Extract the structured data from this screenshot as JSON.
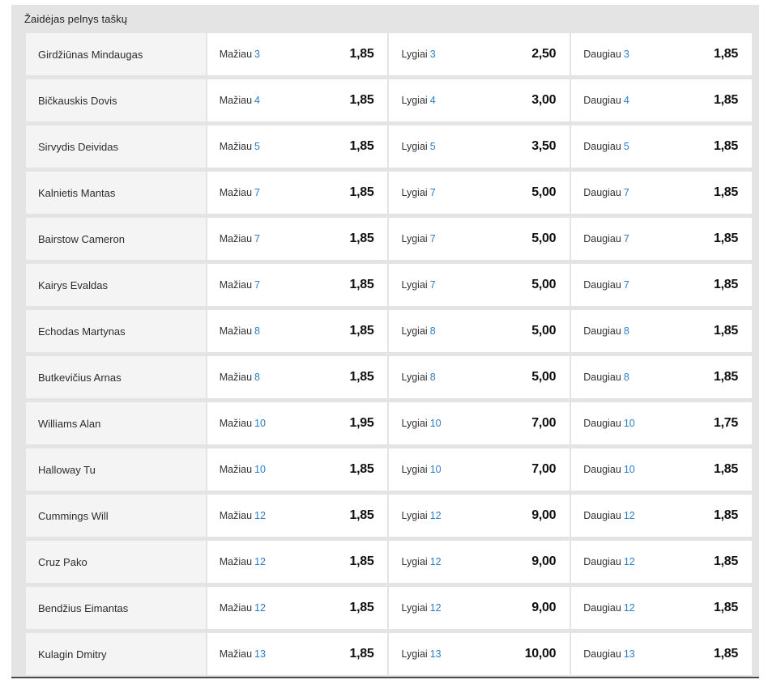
{
  "market": {
    "title": "Žaidėjas pelnys taškų",
    "labels": {
      "under": "Mažiau",
      "equal": "Lygiai",
      "over": "Daugiau"
    }
  },
  "rows": [
    {
      "player": "Girdžiūnas Mindaugas",
      "line": "3",
      "under": "1,85",
      "equal": "2,50",
      "over": "1,85"
    },
    {
      "player": "Bičkauskis Dovis",
      "line": "4",
      "under": "1,85",
      "equal": "3,00",
      "over": "1,85"
    },
    {
      "player": "Sirvydis Deividas",
      "line": "5",
      "under": "1,85",
      "equal": "3,50",
      "over": "1,85"
    },
    {
      "player": "Kalnietis Mantas",
      "line": "7",
      "under": "1,85",
      "equal": "5,00",
      "over": "1,85"
    },
    {
      "player": "Bairstow Cameron",
      "line": "7",
      "under": "1,85",
      "equal": "5,00",
      "over": "1,85"
    },
    {
      "player": "Kairys Evaldas",
      "line": "7",
      "under": "1,85",
      "equal": "5,00",
      "over": "1,85"
    },
    {
      "player": "Echodas Martynas",
      "line": "8",
      "under": "1,85",
      "equal": "5,00",
      "over": "1,85"
    },
    {
      "player": "Butkevičius Arnas",
      "line": "8",
      "under": "1,85",
      "equal": "5,00",
      "over": "1,85"
    },
    {
      "player": "Williams Alan",
      "line": "10",
      "under": "1,95",
      "equal": "7,00",
      "over": "1,75"
    },
    {
      "player": "Halloway Tu",
      "line": "10",
      "under": "1,85",
      "equal": "7,00",
      "over": "1,85"
    },
    {
      "player": "Cummings Will",
      "line": "12",
      "under": "1,85",
      "equal": "9,00",
      "over": "1,85"
    },
    {
      "player": "Cruz Pako",
      "line": "12",
      "under": "1,85",
      "equal": "9,00",
      "over": "1,85"
    },
    {
      "player": "Bendžius Eimantas",
      "line": "12",
      "under": "1,85",
      "equal": "9,00",
      "over": "1,85"
    },
    {
      "player": "Kulagin Dmitry",
      "line": "13",
      "under": "1,85",
      "equal": "10,00",
      "over": "1,85"
    }
  ],
  "colors": {
    "line_accent": "#2a7ec9",
    "panel_bg": "#e4e4e4",
    "name_cell_bg": "#f4f4f4",
    "odd_cell_bg": "#ffffff"
  }
}
